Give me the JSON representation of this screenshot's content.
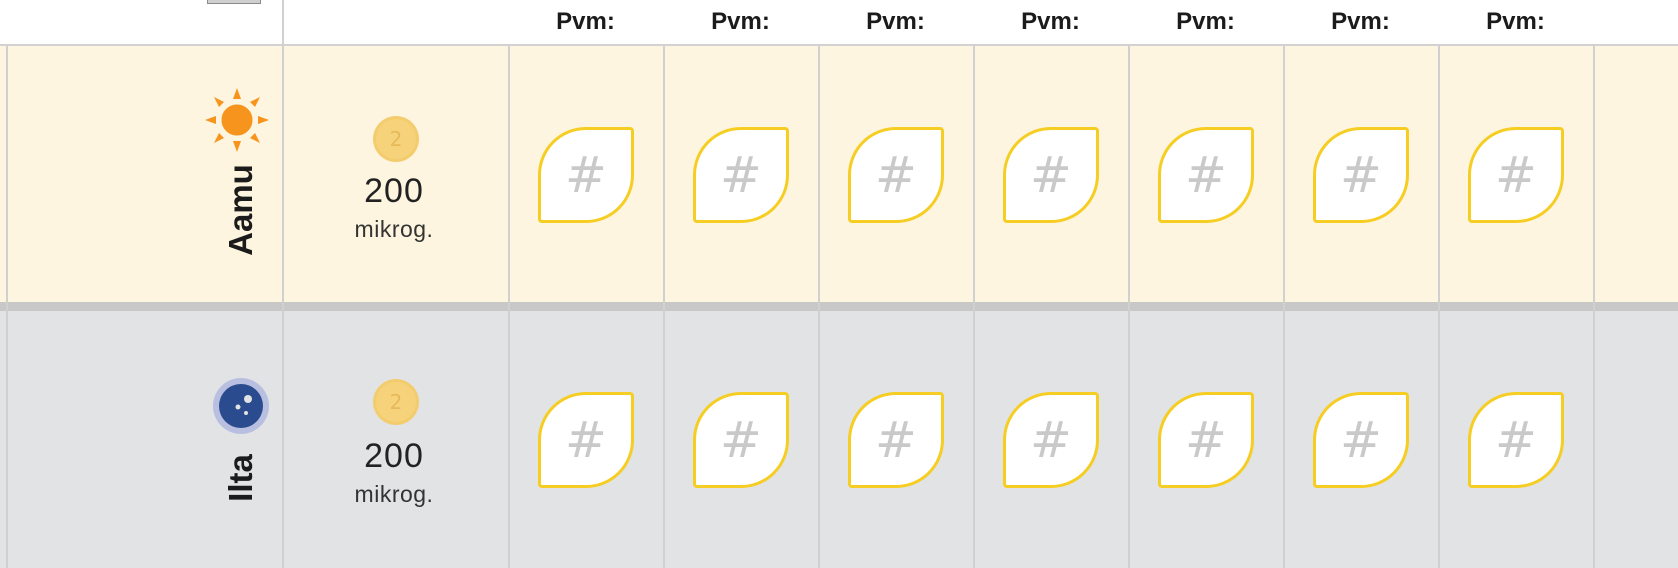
{
  "header": {
    "day_label": "Pvm:"
  },
  "rows": [
    {
      "period": "Aamu",
      "icon": "sun-icon",
      "dose_amount": "200",
      "dose_unit": "mikrog.",
      "pill_icon": "tablet-icon"
    },
    {
      "period": "Ilta",
      "icon": "moon-icon",
      "dose_amount": "200",
      "dose_unit": "mikrog.",
      "pill_icon": "tablet-icon"
    }
  ],
  "cell_placeholder": "#",
  "colors": {
    "morning_bg": "#fdf5df",
    "evening_bg": "#e1e3e4",
    "box_border": "#f6cd22",
    "sun": "#f7941d",
    "moon": "#2a4b8d"
  }
}
